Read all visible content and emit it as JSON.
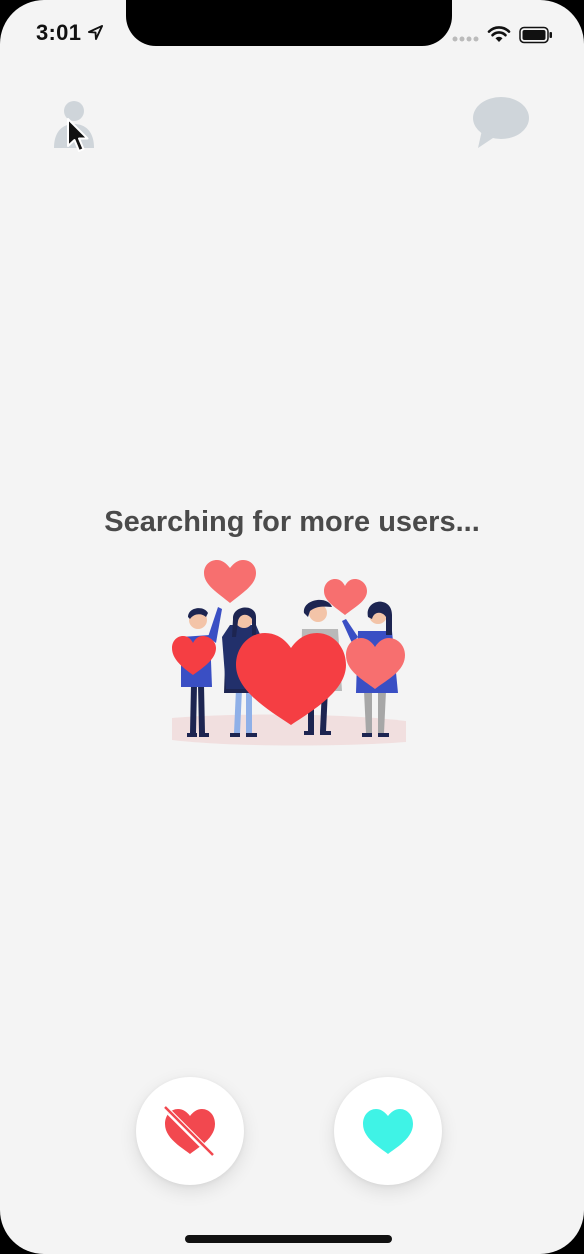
{
  "status_bar": {
    "time": "3:01"
  },
  "main": {
    "status_message": "Searching for more users..."
  },
  "icons": {
    "profile": "user-icon",
    "chat": "chat-bubble-icon",
    "dislike": "broken-heart-icon",
    "like": "heart-icon",
    "illustration": "people-holding-hearts-illustration"
  },
  "colors": {
    "background": "#f4f4f4",
    "text": "#4a4a4a",
    "dislike": "#f2484f",
    "like": "#3ff3e6",
    "inactive_icon": "#cfd5da"
  }
}
